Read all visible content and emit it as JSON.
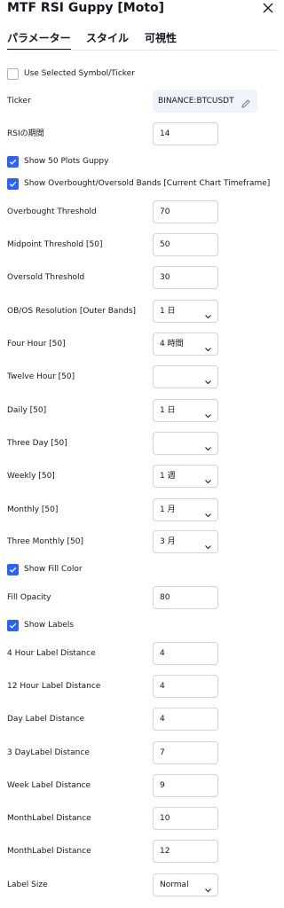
{
  "dialog": {
    "title": "MTF RSI Guppy [Moto]",
    "tabs": [
      {
        "label": "パラメーター",
        "active": true
      },
      {
        "label": "スタイル",
        "active": false
      },
      {
        "label": "可視性",
        "active": false
      }
    ]
  },
  "colors": {
    "accent": "#2962ff",
    "border": "#d1d4dc",
    "text": "#131722",
    "ticker_bg": "#f0f3fa"
  },
  "params": {
    "use_selected_symbol": {
      "label": "Use Selected Symbol/Ticker",
      "checked": false
    },
    "ticker": {
      "label": "Ticker",
      "value": "BINANCE:BTCUSDT",
      "icon": "pencil-icon"
    },
    "rsi_period": {
      "label": "RSIの期間",
      "value": "14"
    },
    "show_50_plots": {
      "label": "Show 50 Plots Guppy",
      "checked": true
    },
    "show_bands": {
      "label": "Show Overbought/Oversold Bands [Current Chart Timeframe]",
      "checked": true
    },
    "overbought": {
      "label": "Overbought Threshold",
      "value": "70"
    },
    "midpoint": {
      "label": "Midpoint Threshold [50]",
      "value": "50"
    },
    "oversold": {
      "label": "Oversold Threshold",
      "value": "30"
    },
    "obos_resolution": {
      "label": "OB/OS Resolution [Outer Bands]",
      "value": "1 日"
    },
    "four_hour": {
      "label": "Four Hour [50]",
      "value": "4 時間"
    },
    "twelve_hour": {
      "label": "Twelve Hour [50]",
      "value": ""
    },
    "daily": {
      "label": "Daily [50]",
      "value": "1 日"
    },
    "three_day": {
      "label": "Three Day [50]",
      "value": ""
    },
    "weekly": {
      "label": "Weekly [50]",
      "value": "1 週"
    },
    "monthly": {
      "label": "Monthly [50]",
      "value": "1 月"
    },
    "three_monthly": {
      "label": "Three Monthly [50]",
      "value": "3 月"
    },
    "show_fill": {
      "label": "Show Fill Color",
      "checked": true
    },
    "fill_opacity": {
      "label": "Fill Opacity",
      "value": "80"
    },
    "show_labels": {
      "label": "Show Labels",
      "checked": true
    },
    "label_4h": {
      "label": "4 Hour Label Distance",
      "value": "4"
    },
    "label_12h": {
      "label": "12 Hour Label Distance",
      "value": "4"
    },
    "label_day": {
      "label": "Day Label Distance",
      "value": "4"
    },
    "label_3day": {
      "label": "3 DayLabel Distance",
      "value": "7"
    },
    "label_week": {
      "label": "Week Label Distance",
      "value": "9"
    },
    "label_month": {
      "label": "MonthLabel Distance",
      "value": "10"
    },
    "label_month2": {
      "label": "MonthLabel Distance",
      "value": "12"
    },
    "label_size": {
      "label": "Label Size",
      "value": "Normal"
    }
  }
}
